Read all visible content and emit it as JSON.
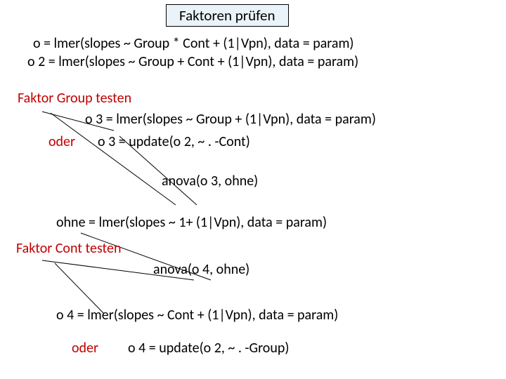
{
  "title": "Faktoren prüfen",
  "lines": {
    "o": "o = lmer(slopes ~ Group * Cont + (1|Vpn), data = param)",
    "o2": "o 2 =  lmer(slopes ~ Group + Cont + (1|Vpn), data = param)",
    "groupTest": "Faktor Group testen",
    "o3a": "o 3 =  lmer(slopes ~ Group + (1|Vpn), data = param)",
    "oder1": "oder",
    "o3b": "o 3 = update(o 2, ~ . -Cont)",
    "anova3": "anova(o 3, ohne)",
    "ohne": "ohne =  lmer(slopes ~ 1+ (1|Vpn), data = param)",
    "contTest": "Faktor Cont testen",
    "anova4": "anova(o 4, ohne)",
    "o4a": "o 4 =  lmer(slopes ~ Cont + (1|Vpn), data = param)",
    "oder2": "oder",
    "o4b": "o 4 = update(o 2, ~ . -Group)"
  }
}
